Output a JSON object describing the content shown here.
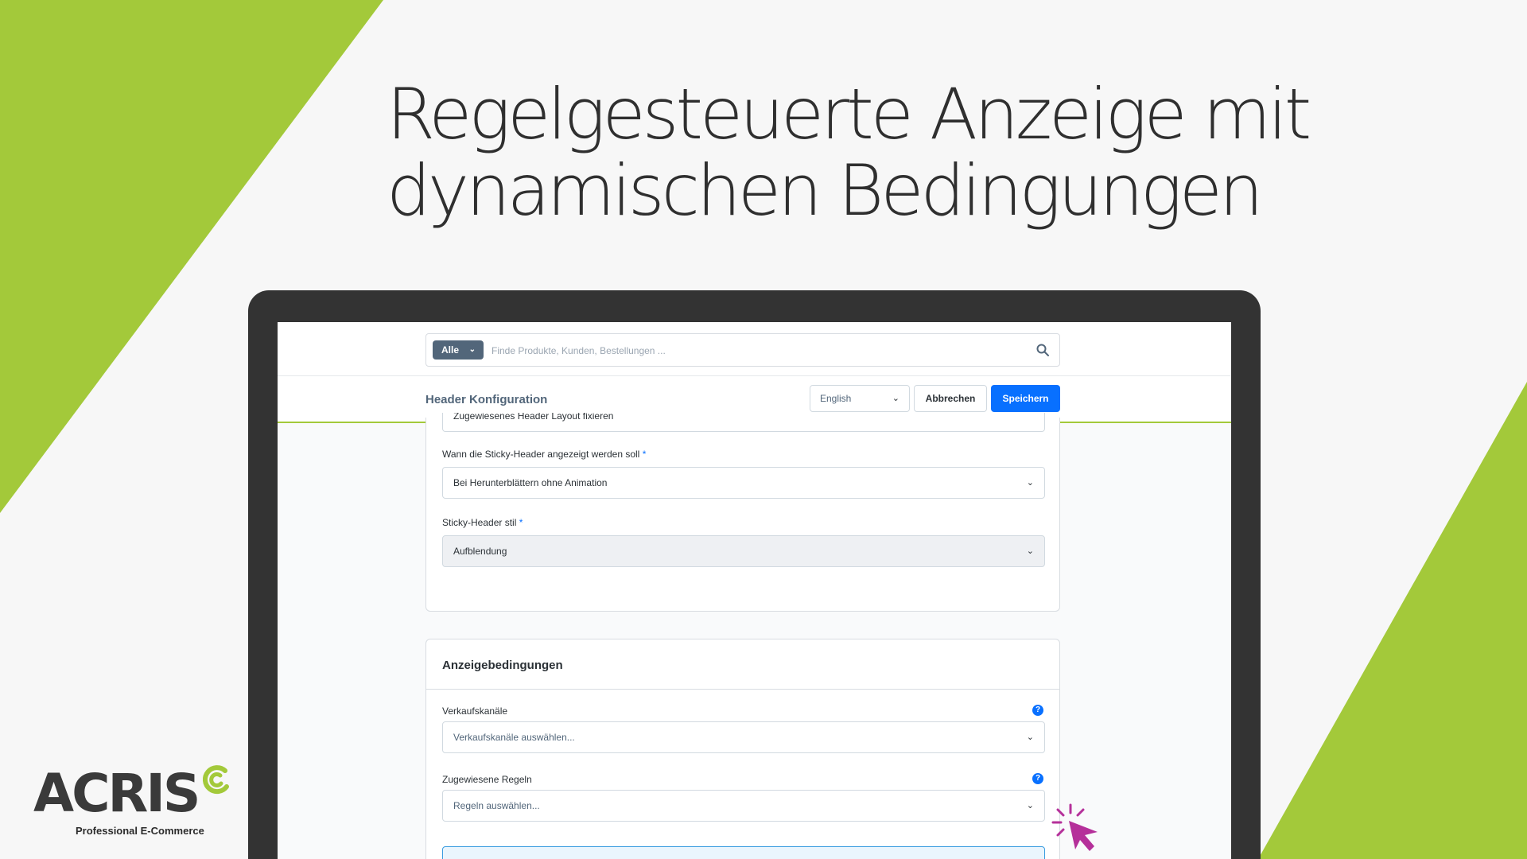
{
  "headline": {
    "line1": "Regelgesteuerte Anzeige mit",
    "line2": "dynamischen Bedingungen"
  },
  "colors": {
    "accent_green": "#a3c93a",
    "primary_blue": "#0870ff",
    "cursor_magenta": "#b5309a"
  },
  "search": {
    "scope_label": "Alle",
    "placeholder": "Finde Produkte, Kunden, Bestellungen ..."
  },
  "config_bar": {
    "title": "Header Konfiguration",
    "language": "English",
    "cancel_label": "Abbrechen",
    "save_label": "Speichern"
  },
  "layout_card": {
    "cut_field_value": "Zugewiesenes Header Layout fixieren",
    "sticky_when_label": "Wann die Sticky-Header angezeigt werden soll",
    "sticky_when_value": "Bei Herunterblättern ohne Animation",
    "sticky_style_label": "Sticky-Header stil",
    "sticky_style_value": "Aufblendung",
    "required_marker": "*"
  },
  "conditions_card": {
    "title": "Anzeigebedingungen",
    "sales_channels_label": "Verkaufskanäle",
    "sales_channels_placeholder": "Verkaufskanäle auswählen...",
    "rules_label": "Zugewiesene Regeln",
    "rules_placeholder": "Regeln auswählen...",
    "help_glyph": "?"
  },
  "logo": {
    "wordmark": "ACRIS",
    "tagline": "Professional E-Commerce"
  }
}
